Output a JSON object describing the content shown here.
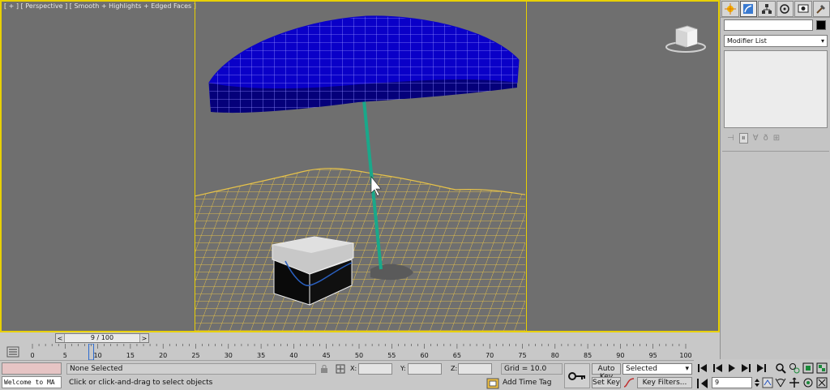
{
  "viewport": {
    "label_parts": [
      "[ + ]",
      "[ Perspective ]",
      "[ Smooth + Highlights + Edged Faces ]"
    ]
  },
  "command_panel": {
    "tabs": [
      "create-icon",
      "modify-icon",
      "hierarchy-icon",
      "motion-icon",
      "display-icon",
      "utilities-icon"
    ],
    "object_name": "",
    "object_color": "#000000",
    "modifier_list": "Modifier List"
  },
  "timeline": {
    "slider_prev": "<",
    "slider_label": "9 / 100",
    "slider_next": ">",
    "current_frame": 9,
    "start": 0,
    "end": 100,
    "ruler_labels": [
      "0",
      "5",
      "10",
      "15",
      "20",
      "25",
      "30",
      "35",
      "40",
      "45",
      "50",
      "55",
      "60",
      "65",
      "70",
      "75",
      "80",
      "85",
      "90",
      "95",
      "100"
    ]
  },
  "status": {
    "maxscript_text": "Welcome to MA",
    "selection": "None Selected",
    "prompt": "Click or click-and-drag to select objects",
    "x_label": "X:",
    "y_label": "Y:",
    "z_label": "Z:",
    "x_value": "",
    "y_value": "",
    "z_value": "",
    "grid": "Grid = 10.0",
    "add_time_tag": "Add Time Tag"
  },
  "animation": {
    "auto_key": "Auto Key",
    "set_key": "Set Key",
    "selected_dropdown": "Selected",
    "key_filters": "Key Filters...",
    "frame_value": "9"
  },
  "colors": {
    "viewport_bg": "#6f6f6f",
    "active_border": "#e8d000",
    "umbrella": "#0a00c8",
    "terrain": "#e8c44a",
    "pole": "#1aa88a"
  }
}
